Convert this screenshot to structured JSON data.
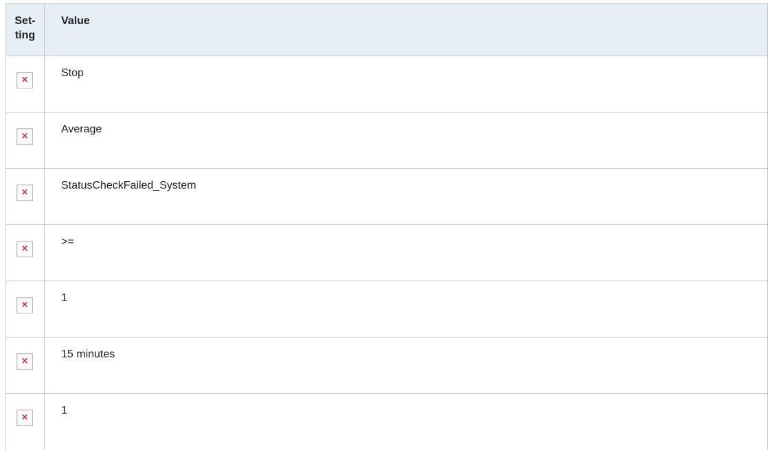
{
  "table": {
    "headers": {
      "setting_part1": "Set-",
      "setting_part2": "ting",
      "value": "Value"
    },
    "broken_image_glyph": "×",
    "rows": [
      {
        "icon": "broken-image-icon",
        "value": "Stop"
      },
      {
        "icon": "broken-image-icon",
        "value": "Average"
      },
      {
        "icon": "broken-image-icon",
        "value": "StatusCheckFailed_System"
      },
      {
        "icon": "broken-image-icon",
        "value": ">="
      },
      {
        "icon": "broken-image-icon",
        "value": "1"
      },
      {
        "icon": "broken-image-icon",
        "value": "15 minutes"
      },
      {
        "icon": "broken-image-icon",
        "value": "1"
      }
    ]
  },
  "colors": {
    "header_bg": "#e6eef6",
    "border": "#c3c6c9",
    "broken_icon_x": "#d6282b"
  }
}
